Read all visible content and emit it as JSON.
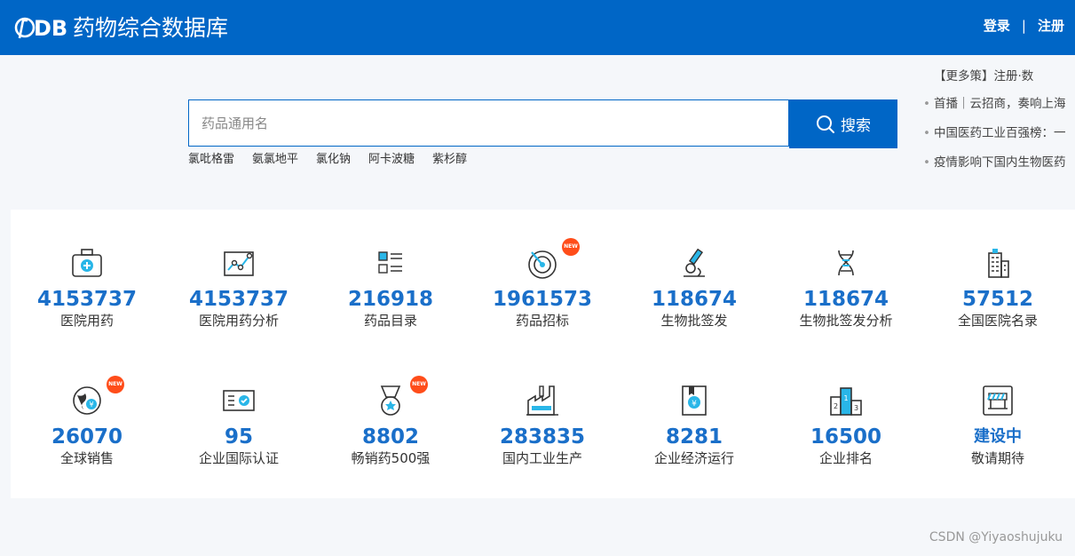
{
  "header": {
    "logo_mark": "DB",
    "title": "药物综合数据库",
    "login_label": "登录",
    "separator": "|",
    "register_label": "注册",
    "bg_color": "#0066c6"
  },
  "search": {
    "placeholder": "药品通用名",
    "button_label": "搜索",
    "hot_keywords": [
      "氯吡格雷",
      "氨氯地平",
      "氯化钠",
      "阿卡波糖",
      "紫杉醇"
    ]
  },
  "news": {
    "items": [
      "【更多策】注册·数",
      "首播｜云招商，奏响上海",
      "中国医药工业百强榜：一",
      "疫情影响下国内生物医药"
    ]
  },
  "stats": [
    {
      "value": "4153737",
      "label": "医院用药",
      "icon": "medical-kit-icon",
      "new": false
    },
    {
      "value": "4153737",
      "label": "医院用药分析",
      "icon": "trend-chart-icon",
      "new": false
    },
    {
      "value": "216918",
      "label": "药品目录",
      "icon": "list-icon",
      "new": false
    },
    {
      "value": "1961573",
      "label": "药品招标",
      "icon": "target-icon",
      "new": true
    },
    {
      "value": "118674",
      "label": "生物批签发",
      "icon": "microscope-icon",
      "new": false
    },
    {
      "value": "118674",
      "label": "生物批签发分析",
      "icon": "dna-icon",
      "new": false
    },
    {
      "value": "57512",
      "label": "全国医院名录",
      "icon": "building-icon",
      "new": false
    },
    {
      "value": "26070",
      "label": "全球销售",
      "icon": "globe-coin-icon",
      "new": true
    },
    {
      "value": "95",
      "label": "企业国际认证",
      "icon": "certificate-icon",
      "new": false
    },
    {
      "value": "8802",
      "label": "畅销药500强",
      "icon": "medal-icon",
      "new": true
    },
    {
      "value": "283835",
      "label": "国内工业生产",
      "icon": "factory-icon",
      "new": false
    },
    {
      "value": "8281",
      "label": "企业经济运行",
      "icon": "yen-book-icon",
      "new": false
    },
    {
      "value": "16500",
      "label": "企业排名",
      "icon": "podium-icon",
      "new": false
    },
    {
      "value": "建设中",
      "label": "敬请期待",
      "icon": "construction-icon",
      "new": false
    }
  ],
  "badge_text": "NEW",
  "watermark": "CSDN @Yiyaoshujuku",
  "colors": {
    "accent": "#0066c6",
    "number": "#1a6fc9",
    "badge": "#ff4d1a",
    "icon_highlight": "#29b6e8"
  }
}
